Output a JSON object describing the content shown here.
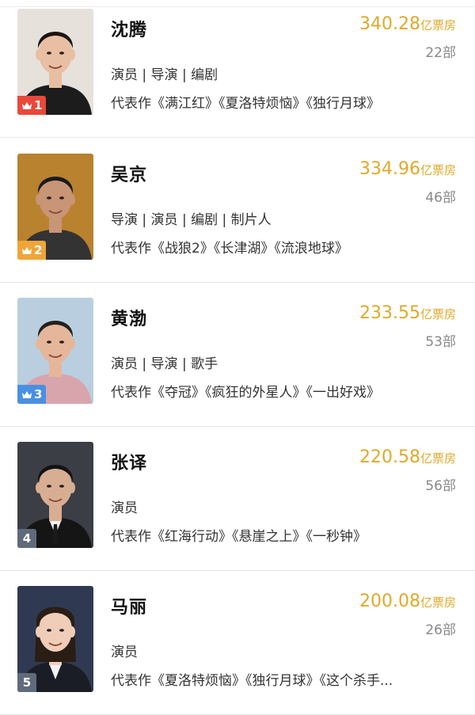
{
  "ranking": [
    {
      "rank": "1",
      "name": "沈腾",
      "box_office_value": "340.28",
      "box_office_unit": "亿票房",
      "film_count": "22部",
      "roles": "演员 | 导演 | 编剧",
      "works": "代表作《满江红》《夏洛特烦恼》《独行月球》",
      "badge_color": "#e8493b",
      "has_crown": true
    },
    {
      "rank": "2",
      "name": "吴京",
      "box_office_value": "334.96",
      "box_office_unit": "亿票房",
      "film_count": "46部",
      "roles": "导演 | 演员 | 编剧 | 制片人",
      "works": "代表作《战狼2》《长津湖》《流浪地球》",
      "badge_color": "#f0a53a",
      "has_crown": true
    },
    {
      "rank": "3",
      "name": "黄渤",
      "box_office_value": "233.55",
      "box_office_unit": "亿票房",
      "film_count": "53部",
      "roles": "演员 | 导演 | 歌手",
      "works": "代表作《夺冠》《疯狂的外星人》《一出好戏》",
      "badge_color": "#4a90e2",
      "has_crown": true
    },
    {
      "rank": "4",
      "name": "张译",
      "box_office_value": "220.58",
      "box_office_unit": "亿票房",
      "film_count": "56部",
      "roles": "演员",
      "works": "代表作《红海行动》《悬崖之上》《一秒钟》",
      "badge_color": "#5f6b7a",
      "has_crown": false
    },
    {
      "rank": "5",
      "name": "马丽",
      "box_office_value": "200.08",
      "box_office_unit": "亿票房",
      "film_count": "26部",
      "roles": "演员",
      "works": "代表作《夏洛特烦恼》《独行月球》《这个杀手...",
      "badge_color": "#5f6b7a",
      "has_crown": false
    }
  ],
  "colors": {
    "accent_gold": "#e0a92a",
    "muted_gray": "#888888"
  },
  "icons": {
    "rank_crown": "crown-icon"
  }
}
